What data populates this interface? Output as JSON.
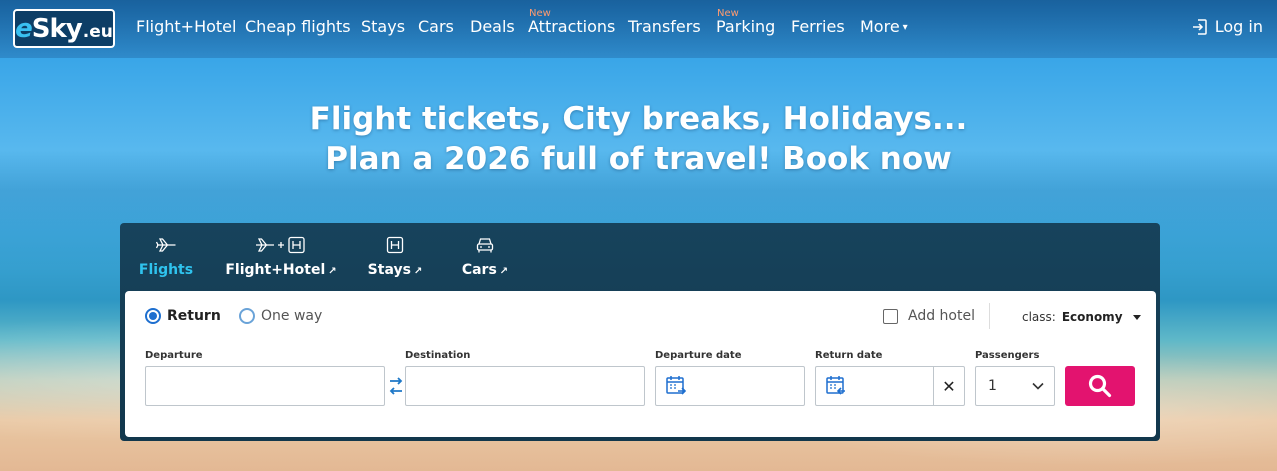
{
  "brand": {
    "logo_e": "e",
    "logo_sky": "Sky",
    "logo_suffix": ".eu"
  },
  "nav": {
    "items": [
      {
        "label": "Flight+Hotel",
        "badge": ""
      },
      {
        "label": "Cheap flights",
        "badge": ""
      },
      {
        "label": "Stays",
        "badge": ""
      },
      {
        "label": "Cars",
        "badge": ""
      },
      {
        "label": "Deals",
        "badge": ""
      },
      {
        "label": "Attractions",
        "badge": "New"
      },
      {
        "label": "Transfers",
        "badge": ""
      },
      {
        "label": "Parking",
        "badge": "New"
      },
      {
        "label": "Ferries",
        "badge": ""
      },
      {
        "label": "More",
        "badge": ""
      }
    ],
    "login_label": "Log in",
    "badge_color": "#ff9b70"
  },
  "hero": {
    "line1": "Flight tickets, City breaks, Holidays...",
    "line2": "Plan a 2026 full of travel! Book now"
  },
  "search": {
    "tabs": [
      {
        "label": "Flights",
        "icon": "plane-icon",
        "active": true
      },
      {
        "label": "Flight+Hotel",
        "icon": "plane-plus-hotel-icon",
        "active": false
      },
      {
        "label": "Stays",
        "icon": "hotel-icon",
        "active": false
      },
      {
        "label": "Cars",
        "icon": "car-icon",
        "active": false
      }
    ],
    "trip_types": {
      "return_label": "Return",
      "oneway_label": "One way",
      "selected": "Return"
    },
    "add_hotel_label": "Add hotel",
    "class_label": "class:",
    "class_value": "Economy",
    "fields": {
      "departure_label": "Departure",
      "departure_value": "",
      "destination_label": "Destination",
      "destination_value": "",
      "departure_date_label": "Departure date",
      "departure_date_value": "",
      "return_date_label": "Return date",
      "return_date_value": "",
      "passengers_label": "Passengers",
      "passengers_value": "1"
    },
    "clear_symbol": "✕",
    "accent_color": "#2fc3ee",
    "search_button_color": "#e3136f"
  }
}
